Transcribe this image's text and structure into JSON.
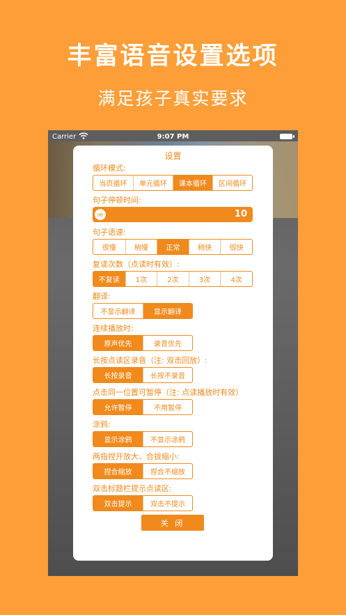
{
  "promo": {
    "headline": "丰富语音设置选项",
    "subline": "满足孩子真实要求"
  },
  "statusbar": {
    "carrier": "Carrier",
    "time": "9:07 PM"
  },
  "dialog": {
    "title": "设置",
    "loop": {
      "label": "循环模式:",
      "options": [
        "当页循环",
        "单元循环",
        "课本循环",
        "区间循环"
      ],
      "selected": 2
    },
    "pause": {
      "label": "句子停顿时间:",
      "knob": "0秒",
      "value": "10",
      "level": 1.0
    },
    "speed": {
      "label": "句子语速:",
      "options": [
        "很慢",
        "稍慢",
        "正常",
        "稍快",
        "很快"
      ],
      "selected": 2
    },
    "repeat": {
      "label": "复读次数（点读时有效）:",
      "options": [
        "不复读",
        "1次",
        "2次",
        "3次",
        "4次"
      ],
      "selected": 0
    },
    "translate": {
      "label": "翻译:",
      "options": [
        "不显示翻译",
        "显示翻译"
      ],
      "selected": 1
    },
    "continuous": {
      "label": "连续播放时:",
      "options": [
        "原声优先",
        "录音优先"
      ],
      "selected": 0
    },
    "longpress": {
      "label": "长按点读区录音（注: 双击回放）:",
      "options": [
        "长按录音",
        "长按不录音"
      ],
      "selected": 0
    },
    "samepos": {
      "label": "点击同一位置可暂停（注: 点读播放时有效）",
      "options": [
        "允许暂停",
        "不用暂停"
      ],
      "selected": 0
    },
    "graffiti": {
      "label": "涂鸦:",
      "options": [
        "显示涂鸦",
        "不显示涂鸦"
      ],
      "selected": 0
    },
    "pinch": {
      "label": "两指捏开放大、合拢缩小:",
      "options": [
        "捏合缩放",
        "捏合不缩放"
      ],
      "selected": 0
    },
    "dbltap": {
      "label": "双击标题栏提示点读区:",
      "options": [
        "双击提示",
        "双击不提示"
      ],
      "selected": 0
    },
    "close_label": "关 闭"
  },
  "colors": {
    "accent": "#F08A1C",
    "background": "#FD9E38"
  }
}
